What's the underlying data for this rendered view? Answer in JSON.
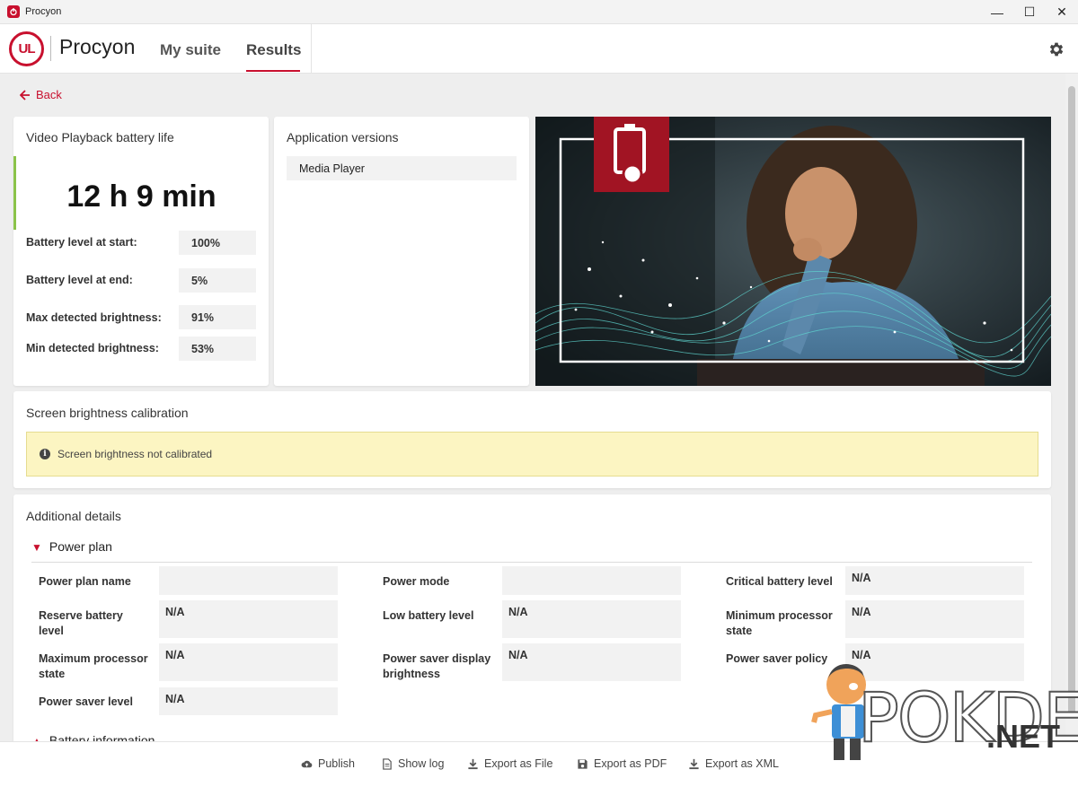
{
  "window": {
    "title": "Procyon",
    "minimize": "—",
    "maximize": "☐",
    "close": "✕"
  },
  "header": {
    "logo_text": "UL",
    "brand": "Procyon",
    "tabs": [
      {
        "label": "My suite"
      },
      {
        "label": "Results"
      }
    ],
    "active_tab": "Results"
  },
  "back_label": "Back",
  "battery": {
    "title": "Video Playback battery life",
    "result": "12 h 9 min",
    "rows": [
      {
        "label": "Battery level at start:",
        "value": "100%"
      },
      {
        "label": "Battery level at end:",
        "value": "5%"
      },
      {
        "label": "Max detected brightness:",
        "value": "91%"
      },
      {
        "label": "Min detected brightness:",
        "value": "53%"
      }
    ]
  },
  "app_versions": {
    "title": "Application versions",
    "items": [
      "Media Player"
    ]
  },
  "calibration": {
    "title": "Screen brightness calibration",
    "message": "Screen brightness not calibrated"
  },
  "details": {
    "title": "Additional details",
    "power_plan": {
      "heading": "Power plan",
      "fields": [
        {
          "label": "Power plan name",
          "value": ""
        },
        {
          "label": "Power mode",
          "value": ""
        },
        {
          "label": "Critical battery level",
          "value": "N/A"
        },
        {
          "label": "Reserve battery level",
          "value": "N/A"
        },
        {
          "label": "Low battery level",
          "value": "N/A"
        },
        {
          "label": "Minimum processor state",
          "value": "N/A"
        },
        {
          "label": "Maximum processor state",
          "value": "N/A"
        },
        {
          "label": "Power saver display brightness",
          "value": "N/A"
        },
        {
          "label": "Power saver policy",
          "value": "N/A"
        },
        {
          "label": "Power saver level",
          "value": "N/A"
        }
      ]
    },
    "next_heading": "Battery information"
  },
  "footer": {
    "buttons": [
      "Publish",
      "Show log",
      "Export as File",
      "Export as PDF",
      "Export as XML"
    ]
  },
  "watermark": {
    "text": "POKDE",
    "suffix": ".NET"
  },
  "colors": {
    "accent": "#c8102e",
    "success_bar": "#8bc34a",
    "warning_bg": "#fcf5c2"
  },
  "icons": {
    "settings": "gear-icon",
    "back": "arrow-left-icon",
    "info": "info-icon",
    "battery": "battery-icon"
  }
}
